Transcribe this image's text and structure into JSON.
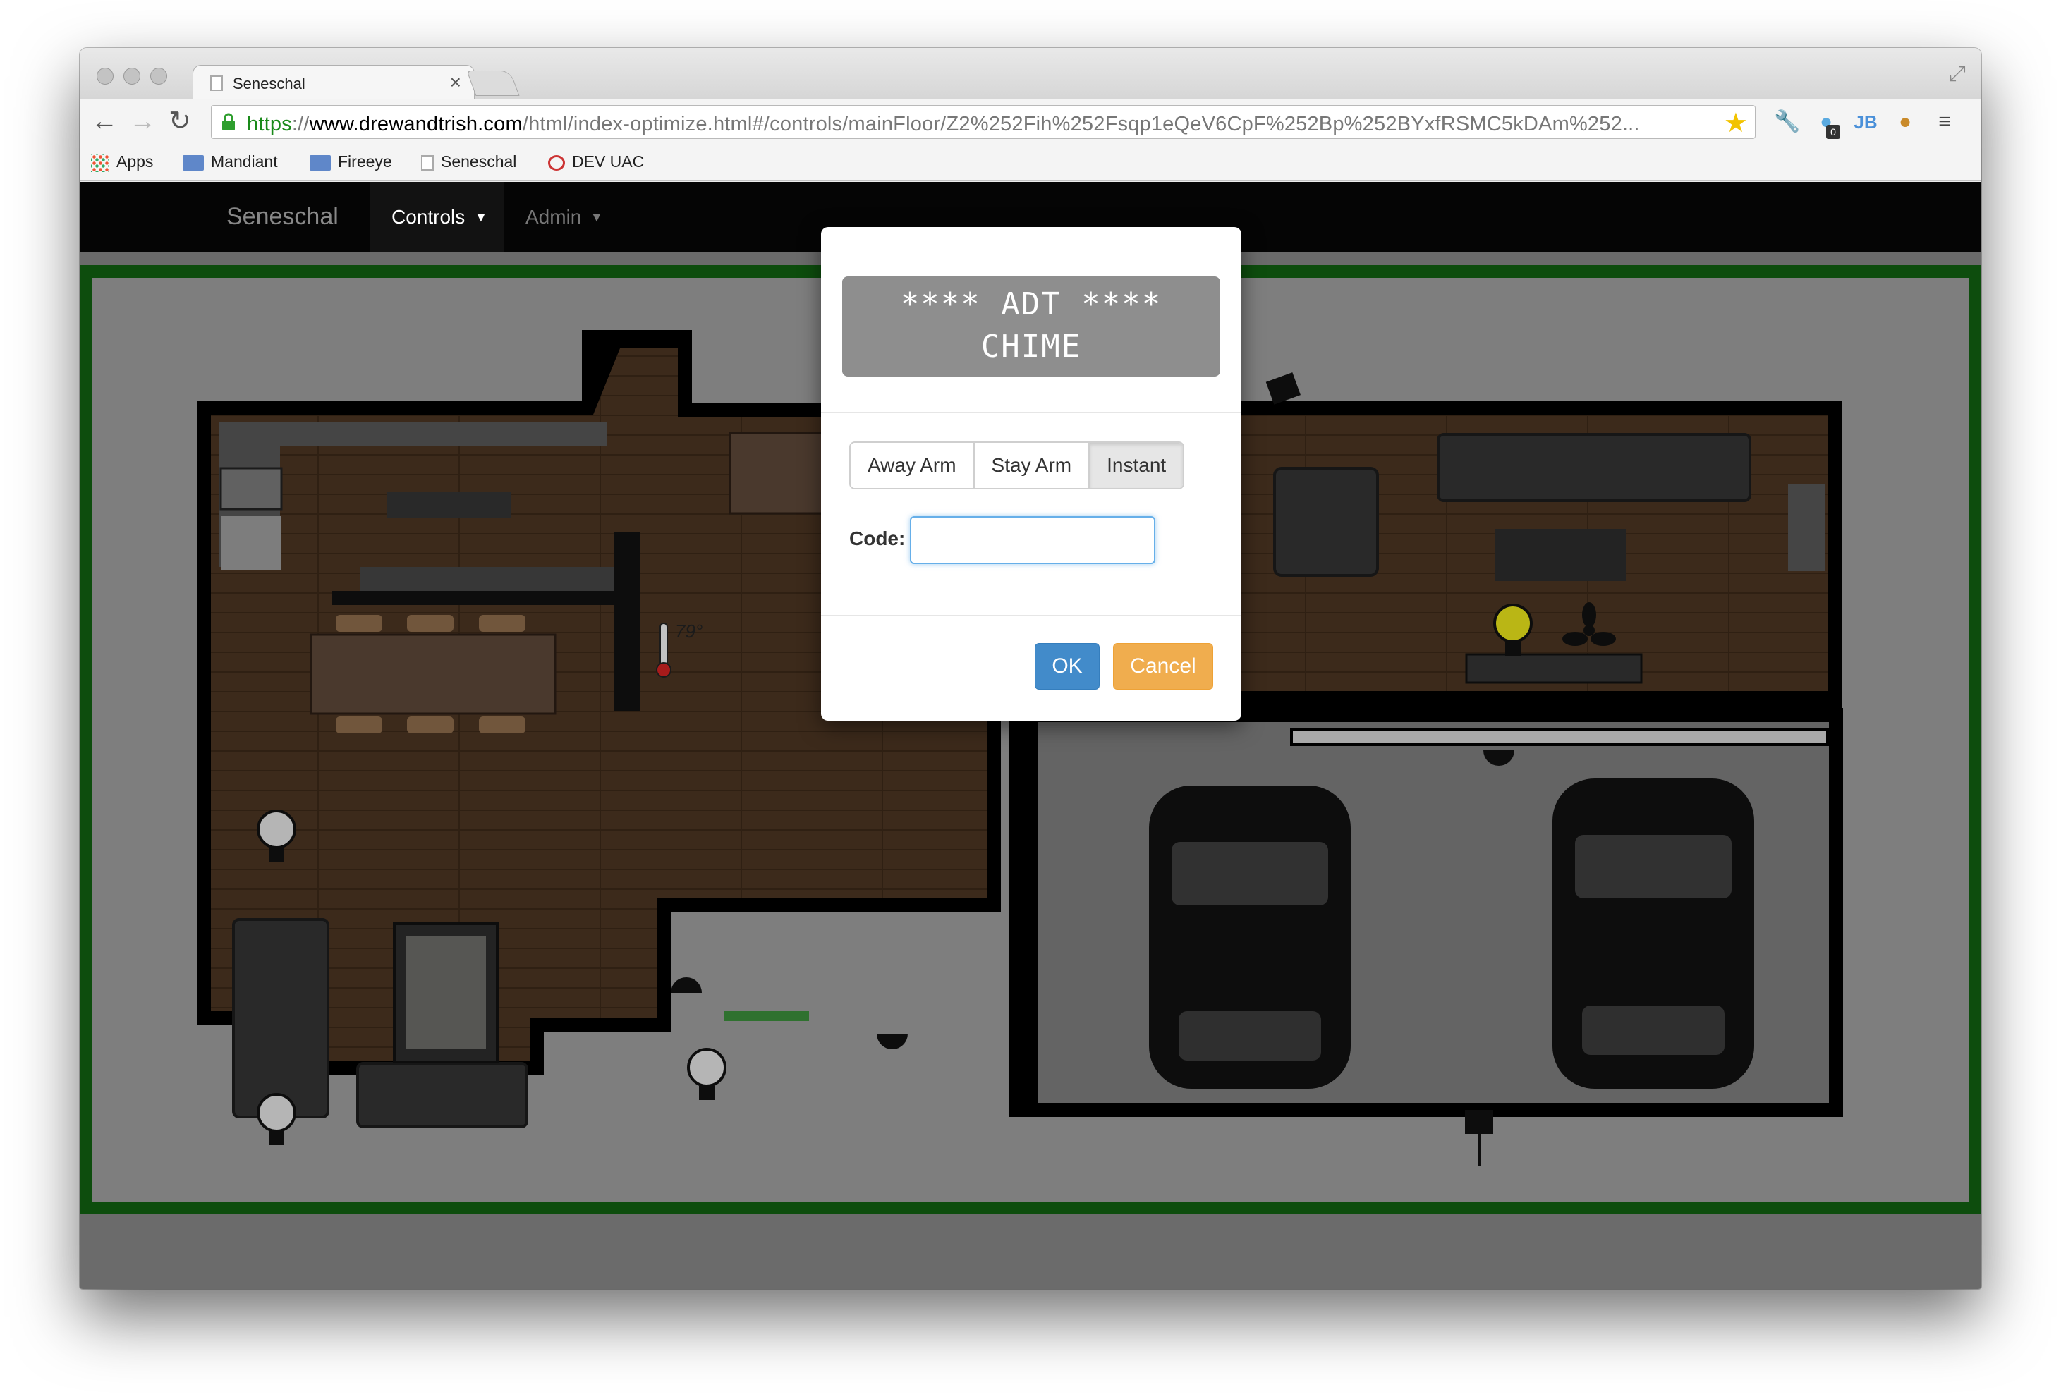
{
  "browser": {
    "tab_title": "Seneschal",
    "tab_close": "×",
    "url_scheme": "https",
    "url_sep": "://",
    "url_host": "www.drewandtrish.com",
    "url_path": "/html/index-optimize.html#/controls/mainFloor/Z2%252Fih%252Fsqp1eQeV6CpF%252Bp%252BYxfRSMC5kDAm%252...",
    "extension_badge": "0"
  },
  "bookmarks": [
    {
      "label": "Apps",
      "icon": "apps-grid-icon"
    },
    {
      "label": "Mandiant",
      "icon": "folder-icon"
    },
    {
      "label": "Fireeye",
      "icon": "folder-icon"
    },
    {
      "label": "Seneschal",
      "icon": "page-icon"
    },
    {
      "label": "DEV UAC",
      "icon": "bookmark-favicon-icon"
    }
  ],
  "navbar": {
    "brand": "Seneschal",
    "controls": "Controls",
    "admin": "Admin"
  },
  "floorplan": {
    "temperature": "79°",
    "icons": [
      "light-bulb-icon",
      "ceiling-fan-icon",
      "camera-icon",
      "spotlight-icon",
      "thermometer-icon",
      "car-icon"
    ],
    "light_on_color": "#e3df1a"
  },
  "modal": {
    "lcd_line1": "**** ADT ****",
    "lcd_line2": "CHIME",
    "buttons": [
      "Away Arm",
      "Stay Arm",
      "Instant"
    ],
    "active_button": "Instant",
    "code_label": "Code:",
    "code_value": "",
    "ok": "OK",
    "cancel": "Cancel"
  },
  "colors": {
    "primary": "#428bca",
    "warning": "#f0ad4e",
    "wall_border": "#0d4d0d"
  }
}
